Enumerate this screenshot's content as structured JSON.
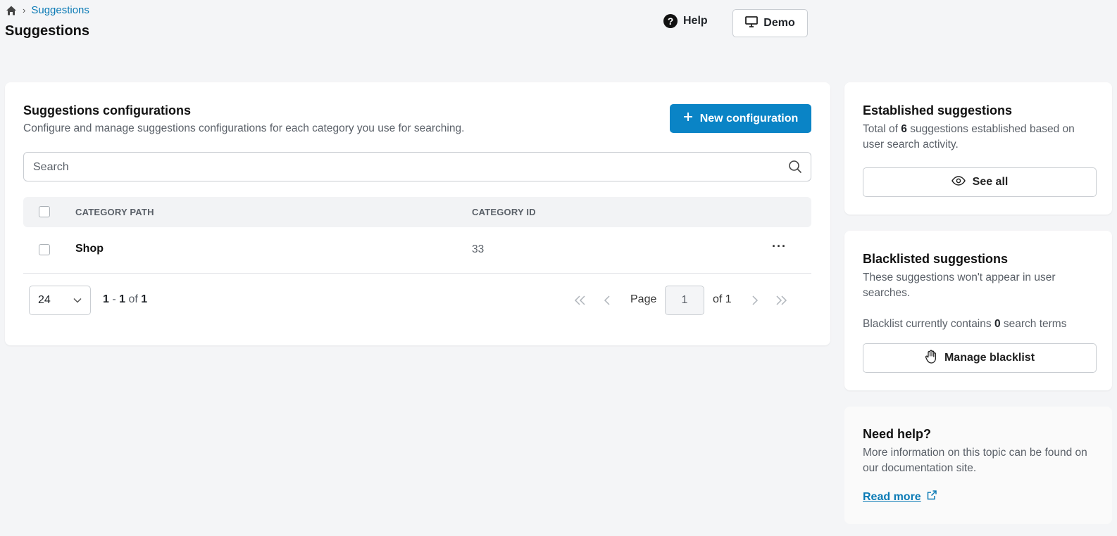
{
  "breadcrumb": {
    "home_icon": "home-icon",
    "current": "Suggestions"
  },
  "page_title": "Suggestions",
  "header": {
    "help_label": "Help",
    "demo_label": "Demo"
  },
  "config": {
    "title": "Suggestions configurations",
    "description": "Configure and manage suggestions configurations for each category you use for searching.",
    "new_button": "New configuration",
    "search_placeholder": "Search",
    "columns": {
      "path": "CATEGORY PATH",
      "id": "CATEGORY ID"
    },
    "rows": [
      {
        "path": "Shop",
        "id": "33"
      }
    ],
    "per_page": "24",
    "range_start": "1",
    "range_dash": " - ",
    "range_end": "1",
    "range_of": " of ",
    "range_total": "1",
    "page_label": "Page",
    "page_value": "1",
    "page_of": "of 1"
  },
  "established": {
    "title": "Established suggestions",
    "desc_pre": "Total of ",
    "desc_count": "6",
    "desc_post": " suggestions established based on user search activity.",
    "button": "See all"
  },
  "blacklisted": {
    "title": "Blacklisted suggestions",
    "desc": "These suggestions won't appear in user searches.",
    "count_pre": "Blacklist currently contains ",
    "count": "0",
    "count_post": " search terms",
    "button": "Manage blacklist"
  },
  "help_card": {
    "title": "Need help?",
    "desc": "More information on this topic can be found on our documentation site.",
    "link": "Read more"
  },
  "colors": {
    "accent": "#0a84c6",
    "link": "#0a7ab5",
    "background": "#f4f5f7"
  }
}
